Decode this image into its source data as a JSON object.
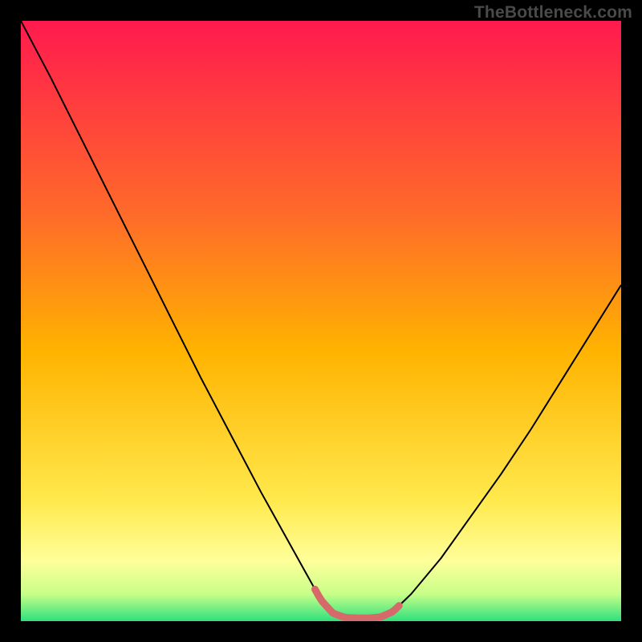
{
  "watermark": "TheBottleneck.com",
  "brand_colors": {
    "frame": "#000000",
    "curve": "#000000",
    "marker": "#d66a6a",
    "gradient_top": "#ff1a4e",
    "gradient_mid": "#ffb300",
    "gradient_low": "#ffff9a",
    "gradient_bottom": "#2fe07e"
  },
  "chart_data": {
    "type": "line",
    "title": "",
    "xlabel": "",
    "ylabel": "",
    "xlim": [
      0,
      100
    ],
    "ylim": [
      0,
      100
    ],
    "grid": false,
    "legend": false,
    "x": [
      0,
      5,
      10,
      15,
      20,
      25,
      30,
      35,
      40,
      45,
      50,
      52,
      54,
      56,
      58,
      60,
      62,
      65,
      70,
      75,
      80,
      85,
      90,
      95,
      100
    ],
    "series": [
      {
        "name": "bottleneck-curve",
        "values": [
          100,
          90.5,
          80.5,
          70.5,
          60.5,
          50.5,
          40.5,
          31.0,
          21.5,
          12.5,
          3.5,
          1.3,
          0.6,
          0.5,
          0.5,
          0.7,
          1.6,
          4.5,
          10.5,
          17.5,
          24.5,
          32.0,
          40.0,
          48.0,
          56.0
        ]
      }
    ],
    "highlight_range_x": [
      49,
      63
    ],
    "background_gradient": {
      "direction": "vertical",
      "stops": [
        {
          "pos": 0.0,
          "color": "#ff1a4e"
        },
        {
          "pos": 0.32,
          "color": "#ff6a2a"
        },
        {
          "pos": 0.55,
          "color": "#ffb300"
        },
        {
          "pos": 0.8,
          "color": "#ffe94d"
        },
        {
          "pos": 0.9,
          "color": "#ffff9a"
        },
        {
          "pos": 0.955,
          "color": "#c7ff88"
        },
        {
          "pos": 1.0,
          "color": "#2fe07e"
        }
      ]
    }
  }
}
